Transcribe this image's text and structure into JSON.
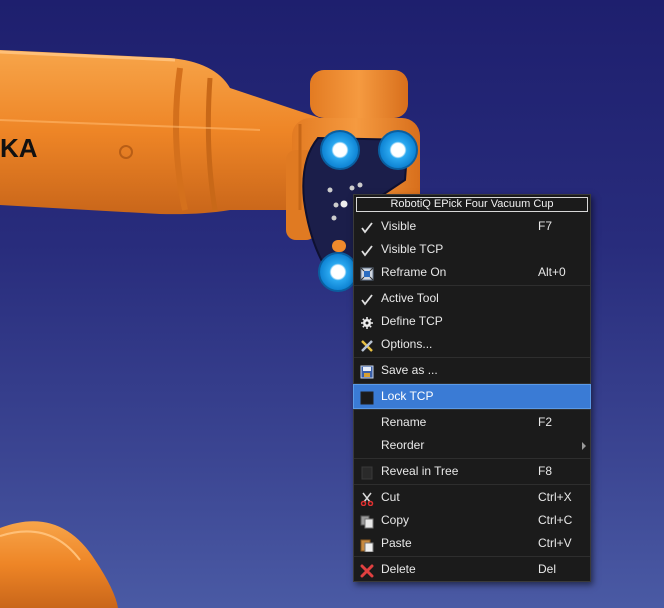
{
  "viewport": {
    "robot_logo_text": "KA"
  },
  "menu": {
    "title": "RobotiQ EPick Four Vacuum Cup",
    "items": [
      {
        "label": "Visible",
        "shortcut": "F7",
        "icon": "check-icon"
      },
      {
        "label": "Visible TCP",
        "shortcut": "",
        "icon": "check-icon"
      },
      {
        "label": "Reframe On",
        "shortcut": "Alt+0",
        "icon": "reframe-icon"
      },
      {
        "label": "Active Tool",
        "shortcut": "",
        "icon": "check-icon"
      },
      {
        "label": "Define TCP",
        "shortcut": "",
        "icon": "gear-icon"
      },
      {
        "label": "Options...",
        "shortcut": "",
        "icon": "options-icon"
      },
      {
        "label": "Save as ...",
        "shortcut": "",
        "icon": "save-icon"
      },
      {
        "label": "Lock TCP",
        "shortcut": "",
        "icon": "lock-box-icon"
      },
      {
        "label": "Rename",
        "shortcut": "F2",
        "icon": ""
      },
      {
        "label": "Reorder",
        "shortcut": "",
        "icon": ""
      },
      {
        "label": "Reveal in Tree",
        "shortcut": "F8",
        "icon": "tree-icon"
      },
      {
        "label": "Cut",
        "shortcut": "Ctrl+X",
        "icon": "scissors-icon"
      },
      {
        "label": "Copy",
        "shortcut": "Ctrl+C",
        "icon": "copy-icon"
      },
      {
        "label": "Paste",
        "shortcut": "Ctrl+V",
        "icon": "paste-icon"
      },
      {
        "label": "Delete",
        "shortcut": "Del",
        "icon": "delete-icon"
      }
    ],
    "highlighted_item": "Lock TCP",
    "colors": {
      "highlight": "#3a7bd5",
      "background": "#1b1b1b",
      "robot_orange": "#f08a2c",
      "cup_blue": "#1e9ee8"
    }
  }
}
